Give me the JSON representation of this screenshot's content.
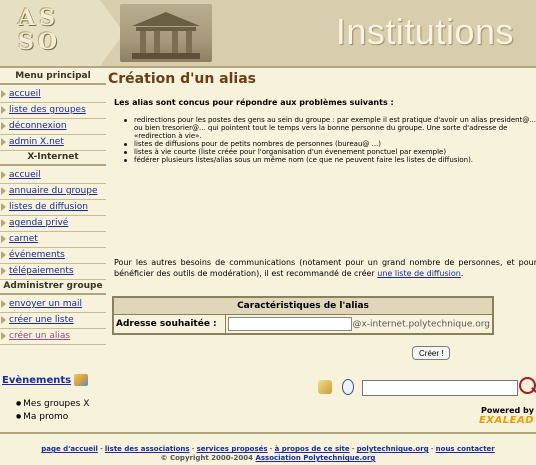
{
  "banner": {
    "logo": "AS SO",
    "title": "Institutions"
  },
  "sidebar": {
    "menu_title": "Menu principal",
    "menu_items": [
      "accueil",
      "liste des groupes",
      "déconnexion",
      "admin X.net"
    ],
    "xinternet_title": "X-Internet",
    "xinternet_items": [
      "accueil",
      "annuaire du groupe",
      "listes de diffusion",
      "agenda privé",
      "carnet",
      "événements",
      "télépaiements"
    ],
    "admin_title": "Administrer groupe",
    "admin_items": [
      "envoyer un mail",
      "créer une liste",
      "créer un alias"
    ]
  },
  "main": {
    "title": "Création d'un alias",
    "intro": "Les alias sont concus pour répondre aux problèmes suivants :",
    "bullets": [
      "redirections pour les postes des gens au sein du groupe : par exemple il est pratique d'avoir un alias president@..., ou bien tresorier@... qui pointent tout le temps vers la bonne personne du groupe. Une sorte d'adresse de «redirection à vie».",
      "listes de diffusions pour de petits nombres de personnes (bureau@ ...)",
      "listes à vie courte (liste créée pour l'organisation d'un évenement ponctuel par exemple)",
      "fédérer plusieurs listes/alias sous un même nom (ce que ne peuvent faire les listes de diffusion)."
    ],
    "para_before_link": "Pour les autres besoins de communications (notament pour un grand nombre de personnes, et pour bénéficier des outils de modération), il est recommandé de créer ",
    "para_link": "une liste de diffusion",
    "para_after": ".",
    "form": {
      "header": "Caractéristiques de l'alias",
      "label": "Adresse souhaitée :",
      "field_value": "",
      "suffix": "@x-internet.polytechnique.org",
      "submit": "Créer !"
    }
  },
  "bottom": {
    "events_title": "Evènements",
    "events_items": [
      "Mes groupes X",
      "Ma promo"
    ],
    "search_value": "",
    "powered_by": "Powered by",
    "exalead_prefix": "EXA",
    "exalead_suffix": "LEAD"
  },
  "footer": {
    "links": [
      "page d'accueil",
      "liste des associations",
      "services proposés",
      "à propos de ce site",
      "polytechnique.org",
      "nous contacter"
    ],
    "copyright_text": "© Copyright 2000-2004 ",
    "copyright_link": "Association Polytechnique.org"
  }
}
